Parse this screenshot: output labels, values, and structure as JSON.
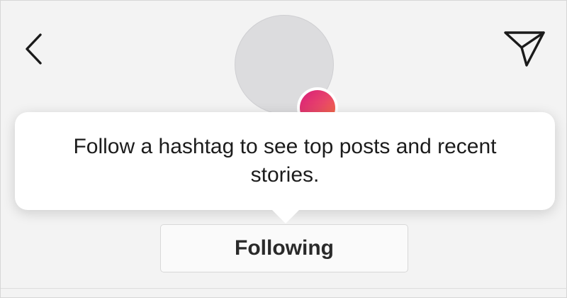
{
  "header": {
    "back_icon": "chevron-left-icon",
    "share_icon": "paper-plane-icon"
  },
  "profile": {
    "avatar_color": "#dcdcde",
    "story_badge_gradient": [
      "#d81b7a",
      "#f77737"
    ]
  },
  "tooltip": {
    "text": "Follow a hashtag to see top posts and recent stories."
  },
  "actions": {
    "following_label": "Following"
  }
}
